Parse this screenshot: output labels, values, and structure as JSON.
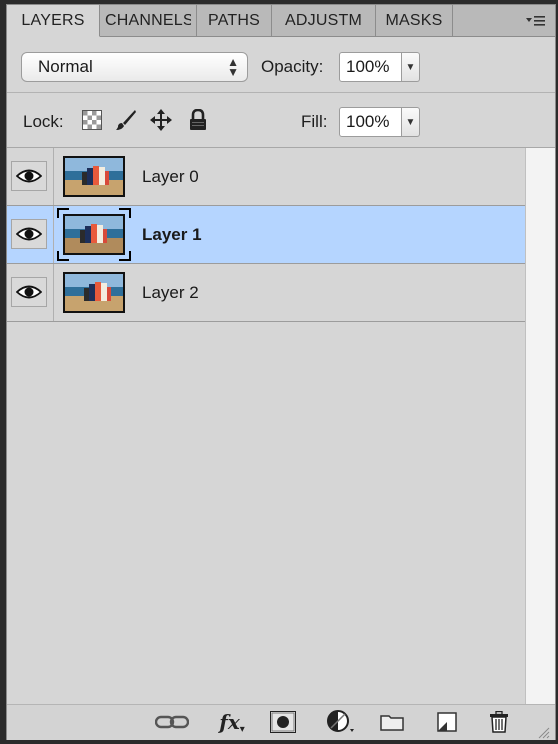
{
  "tabs": [
    {
      "label": "LAYERS",
      "active": true
    },
    {
      "label": "CHANNELS",
      "active": false
    },
    {
      "label": "PATHS",
      "active": false
    },
    {
      "label": "ADJUSTM",
      "active": false
    },
    {
      "label": "MASKS",
      "active": false
    }
  ],
  "options": {
    "blend_mode": "Normal",
    "opacity_label": "Opacity:",
    "opacity_value": "100%",
    "lock_label": "Lock:",
    "fill_label": "Fill:",
    "fill_value": "100%"
  },
  "layers": [
    {
      "name": "Layer 0",
      "visible": true,
      "selected": false
    },
    {
      "name": "Layer 1",
      "visible": true,
      "selected": true
    },
    {
      "name": "Layer 2",
      "visible": true,
      "selected": false
    }
  ],
  "bottom_tools": [
    {
      "icon": "link-icon"
    },
    {
      "icon": "fx-icon",
      "label": "fx"
    },
    {
      "icon": "mask-icon"
    },
    {
      "icon": "adjustment-layer-icon"
    },
    {
      "icon": "group-folder-icon"
    },
    {
      "icon": "new-layer-icon"
    },
    {
      "icon": "trash-icon"
    }
  ],
  "colors": {
    "panel_bg": "#d6d6d6",
    "selected_row": "#b5d5ff",
    "tab_bar": "#b9b9b9"
  }
}
